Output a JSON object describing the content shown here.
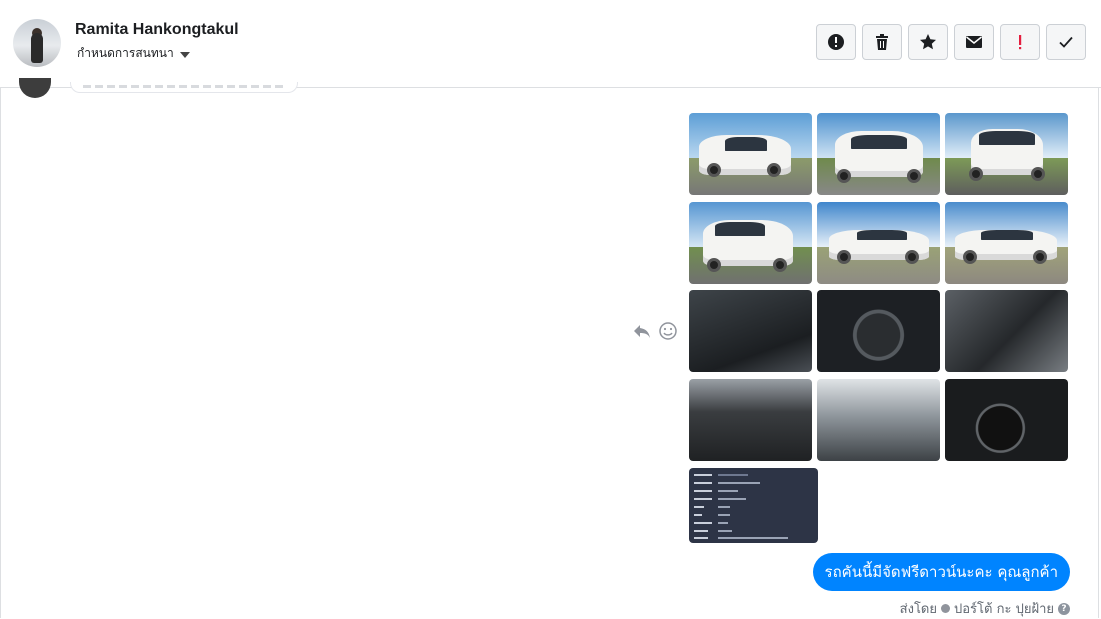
{
  "header": {
    "contact_name": "Ramita Hankongtakul",
    "chat_setup_label": "กำหนดการสนทนา"
  },
  "toolbar": {
    "buttons": [
      {
        "name": "report-spam-button",
        "icon": "alert-circle-icon"
      },
      {
        "name": "delete-button",
        "icon": "trash-icon"
      },
      {
        "name": "star-button",
        "icon": "star-icon"
      },
      {
        "name": "mark-unread-button",
        "icon": "envelope-icon"
      },
      {
        "name": "priority-button",
        "icon": "exclamation-icon"
      },
      {
        "name": "mark-done-button",
        "icon": "check-icon"
      }
    ]
  },
  "message": {
    "text": "รถคันนี้มีจัดฟรีดาวน์นะคะ คุณลูกค้า",
    "sent_by_prefix": "ส่งโดย",
    "sender_name": "ปอร์โต้ กะ ปุยฝ้าย",
    "help_glyph": "?"
  },
  "colors": {
    "bubble": "#0084ff",
    "priority_red": "#e0245e"
  }
}
